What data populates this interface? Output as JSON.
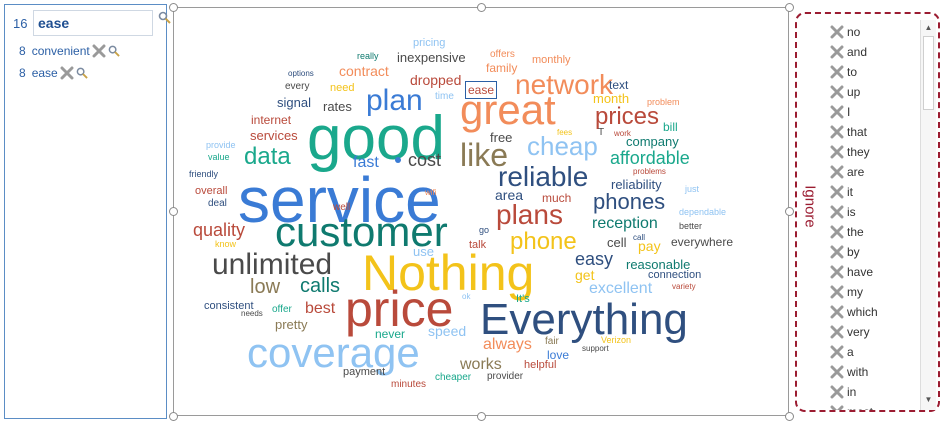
{
  "search": {
    "count": "16",
    "value": "ease"
  },
  "results": [
    {
      "count": "8",
      "word": "convenient"
    },
    {
      "count": "8",
      "word": "ease"
    }
  ],
  "cloud": {
    "highlight_word": "ease",
    "words": [
      {
        "text": "service",
        "color": "#3a7bd5"
      },
      {
        "text": "good",
        "color": "#1aa88c"
      },
      {
        "text": "Nothing",
        "color": "#f3c31a"
      },
      {
        "text": "customer",
        "color": "#0f7a6f"
      },
      {
        "text": "price",
        "color": "#b94a3b"
      },
      {
        "text": "Everything",
        "color": "#2f4f7f"
      },
      {
        "text": "coverage",
        "color": "#8fc3f2"
      },
      {
        "text": "great",
        "color": "#f28c5a"
      },
      {
        "text": "plan",
        "color": "#3a7bd5"
      },
      {
        "text": "like",
        "color": "#8a7a55"
      },
      {
        "text": "unlimited",
        "color": "#4a4a4a"
      },
      {
        "text": "reliable",
        "color": "#2f4f7f"
      },
      {
        "text": "plans",
        "color": "#b94a3b"
      },
      {
        "text": "phone",
        "color": "#f3c31a"
      },
      {
        "text": "network",
        "color": "#f28c5a"
      },
      {
        "text": "cheap",
        "color": "#8fc3f2"
      },
      {
        "text": "prices",
        "color": "#b94a3b"
      },
      {
        "text": "data",
        "color": "#1aa88c"
      },
      {
        "text": "phones",
        "color": "#2f4f7f"
      },
      {
        "text": "quality",
        "color": "#b94a3b"
      },
      {
        "text": "affordable",
        "color": "#1aa88c"
      },
      {
        "text": "calls",
        "color": "#0f7a6f"
      },
      {
        "text": "low",
        "color": "#8a7a55"
      },
      {
        "text": "best",
        "color": "#b94a3b"
      },
      {
        "text": "cost",
        "color": "#4a4a4a"
      },
      {
        "text": "fast",
        "color": "#3a7bd5"
      },
      {
        "text": "reception",
        "color": "#0f7a6f"
      },
      {
        "text": "easy",
        "color": "#2f4f7f"
      },
      {
        "text": "excellent",
        "color": "#8fc3f2"
      },
      {
        "text": "works",
        "color": "#8a7a55"
      },
      {
        "text": "always",
        "color": "#f28c5a"
      },
      {
        "text": "speed",
        "color": "#8fc3f2"
      },
      {
        "text": "never",
        "color": "#1aa88c"
      },
      {
        "text": "pretty",
        "color": "#8a7a55"
      },
      {
        "text": "area",
        "color": "#2f4f7f"
      },
      {
        "text": "much",
        "color": "#b94a3b"
      },
      {
        "text": "reasonable",
        "color": "#0f7a6f"
      },
      {
        "text": "reliability",
        "color": "#2f4f7f"
      },
      {
        "text": "pay",
        "color": "#f3c31a"
      },
      {
        "text": "get",
        "color": "#f3c31a"
      },
      {
        "text": "cell",
        "color": "#4a4a4a"
      },
      {
        "text": "connection",
        "color": "#2f4f7f"
      },
      {
        "text": "everywhere",
        "color": "#4a4a4a"
      },
      {
        "text": "company",
        "color": "#0f7a6f"
      },
      {
        "text": "month",
        "color": "#f3c31a"
      },
      {
        "text": "text",
        "color": "#2f4f7f"
      },
      {
        "text": "bill",
        "color": "#1aa88c"
      },
      {
        "text": "dropped",
        "color": "#b94a3b"
      },
      {
        "text": "contract",
        "color": "#f28c5a"
      },
      {
        "text": "inexpensive",
        "color": "#4a4a4a"
      },
      {
        "text": "pricing",
        "color": "#8fc3f2"
      },
      {
        "text": "offers",
        "color": "#f28c5a"
      },
      {
        "text": "family",
        "color": "#f28c5a"
      },
      {
        "text": "monthly",
        "color": "#f28c5a"
      },
      {
        "text": "rates",
        "color": "#4a4a4a"
      },
      {
        "text": "signal",
        "color": "#2f4f7f"
      },
      {
        "text": "internet",
        "color": "#b94a3b"
      },
      {
        "text": "services",
        "color": "#b94a3b"
      },
      {
        "text": "need",
        "color": "#f3c31a"
      },
      {
        "text": "every",
        "color": "#4a4a4a"
      },
      {
        "text": "options",
        "color": "#2f4f7f"
      },
      {
        "text": "really",
        "color": "#0f7a6f"
      },
      {
        "text": "time",
        "color": "#8fc3f2"
      },
      {
        "text": "ease",
        "color": "#b94a3b"
      },
      {
        "text": "free",
        "color": "#4a4a4a"
      },
      {
        "text": "fees",
        "color": "#f3c31a"
      },
      {
        "text": "T",
        "color": "#4a4a4a"
      },
      {
        "text": "work",
        "color": "#b94a3b"
      },
      {
        "text": "problem",
        "color": "#f28c5a"
      },
      {
        "text": "problems",
        "color": "#b94a3b"
      },
      {
        "text": "just",
        "color": "#8fc3f2"
      },
      {
        "text": "dependable",
        "color": "#8fc3f2"
      },
      {
        "text": "better",
        "color": "#4a4a4a"
      },
      {
        "text": "call",
        "color": "#2f4f7f"
      },
      {
        "text": "talk",
        "color": "#b94a3b"
      },
      {
        "text": "use",
        "color": "#8fc3f2"
      },
      {
        "text": "go",
        "color": "#2f4f7f"
      },
      {
        "text": "well",
        "color": "#b94a3b"
      },
      {
        "text": "wifi",
        "color": "#f28c5a"
      },
      {
        "text": "provide",
        "color": "#8fc3f2"
      },
      {
        "text": "value",
        "color": "#1aa88c"
      },
      {
        "text": "friendly",
        "color": "#2f4f7f"
      },
      {
        "text": "overall",
        "color": "#b94a3b"
      },
      {
        "text": "deal",
        "color": "#2f4f7f"
      },
      {
        "text": "know",
        "color": "#f3c31a"
      },
      {
        "text": "consistent",
        "color": "#2f4f7f"
      },
      {
        "text": "needs",
        "color": "#4a4a4a"
      },
      {
        "text": "offer",
        "color": "#1aa88c"
      },
      {
        "text": "ok",
        "color": "#8fc3f2"
      },
      {
        "text": "It's",
        "color": "#1aa88c"
      },
      {
        "text": "fair",
        "color": "#8a7a55"
      },
      {
        "text": "love",
        "color": "#3a7bd5"
      },
      {
        "text": "Verizon",
        "color": "#f3c31a"
      },
      {
        "text": "support",
        "color": "#4a4a4a"
      },
      {
        "text": "helpful",
        "color": "#b94a3b"
      },
      {
        "text": "provider",
        "color": "#4a4a4a"
      },
      {
        "text": "cheaper",
        "color": "#1aa88c"
      },
      {
        "text": "payment",
        "color": "#4a4a4a"
      },
      {
        "text": "minutes",
        "color": "#b94a3b"
      },
      {
        "text": "variety",
        "color": "#b94a3b"
      }
    ]
  },
  "ignore": {
    "title": "Ignore",
    "words": [
      "no",
      "and",
      "to",
      "up",
      "I",
      "that",
      "they",
      "are",
      "it",
      "is",
      "the",
      "by",
      "have",
      "my",
      "which",
      "very",
      "a",
      "with",
      "in",
      "most"
    ]
  },
  "colors": {
    "accent": "#2b5fa5",
    "ignore_border": "#9b1c31",
    "delete_icon": "#9a9a9a"
  }
}
